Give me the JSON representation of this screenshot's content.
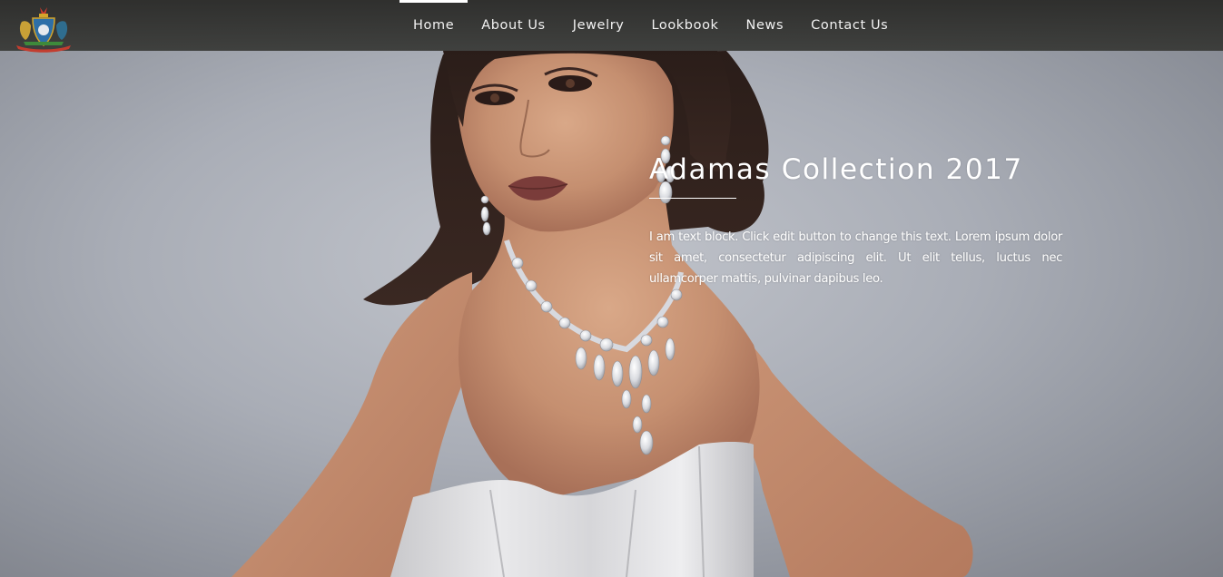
{
  "header": {
    "logo_icon": "royal-coat-of-arms-icon",
    "nav": [
      {
        "label": "Home",
        "active": true
      },
      {
        "label": "About Us",
        "active": false
      },
      {
        "label": "Jewelry",
        "active": false
      },
      {
        "label": "Lookbook",
        "active": false
      },
      {
        "label": "News",
        "active": false
      },
      {
        "label": "Contact Us",
        "active": false
      }
    ]
  },
  "hero": {
    "title": "Adamas Collection 2017",
    "body": "I am text block. Click edit button to change this text. Lorem ipsum dolor sit amet, consectetur adipiscing elit. Ut elit tellus, luctus nec ullamcorper mattis, pulvinar dapibus leo.",
    "image": "woman-wearing-diamond-necklace-and-earrings-photo"
  },
  "colors": {
    "nav_bar": "#2d2d2b",
    "nav_text": "#f2f2f2",
    "active_indicator": "#ffffff",
    "hero_background": "#a9adb6",
    "hero_text": "#ffffff"
  }
}
